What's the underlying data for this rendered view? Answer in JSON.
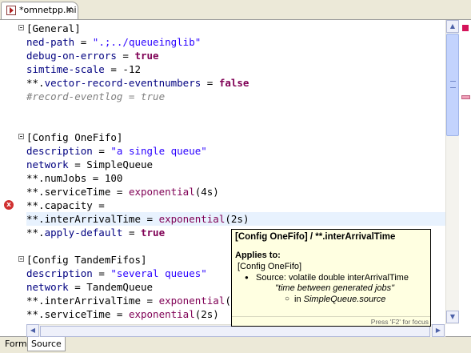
{
  "editor_tab": {
    "title": "*omnetpp.ini",
    "close": "✕"
  },
  "lines": [
    {
      "html": "[General]"
    },
    {
      "html": "<span class='k'>ned-path</span> = <span class='s'>\".;../queueinglib\"</span>"
    },
    {
      "html": "<span class='k'>debug-on-errors</span> = <span class='kw'>true</span>"
    },
    {
      "html": "<span class='k'>simtime-scale</span> = -12"
    },
    {
      "html": "**.<span class='k'>vector-record-eventnumbers</span> = <span class='kw'>false</span>"
    },
    {
      "html": "<span class='cm'>#record-eventlog = true</span>"
    },
    {
      "html": ""
    },
    {
      "html": ""
    },
    {
      "html": "[Config OneFifo]"
    },
    {
      "html": "<span class='k'>description</span> = <span class='s'>\"a single queue\"</span>"
    },
    {
      "html": "<span class='k'>network</span> = SimpleQueue"
    },
    {
      "html": "**.numJobs = 100"
    },
    {
      "html": "**.serviceTime = <span class='fn'>exponential</span>(4s)"
    },
    {
      "html": "**.capacity ="
    },
    {
      "html": "**.interArrivalTime = <span class='fn'>exponential</span>(2s)"
    },
    {
      "html": "**.<span class='k'>apply-default</span> = <span class='kw'>true</span>"
    },
    {
      "html": ""
    },
    {
      "html": "[Config TandemFifos]"
    },
    {
      "html": "<span class='k'>description</span> = <span class='s'>\"several queues\"</span>"
    },
    {
      "html": "<span class='k'>network</span> = TandemQueue"
    },
    {
      "html": "**.interArrivalTime = <span class='fn'>exponential</span>(2s)"
    },
    {
      "html": "**.serviceTime = <span class='fn'>exponential</span>(2s)"
    }
  ],
  "current_line": 14,
  "error_line": 13,
  "error_glyph": "x",
  "fold_lines": [
    0,
    8,
    17
  ],
  "scroll": {
    "up": "▲",
    "down": "▼",
    "left": "◀",
    "right": "▶"
  },
  "popup": {
    "title": "[Config OneFifo] / **.interArrivalTime",
    "applies_label": "Applies to:",
    "config": "[Config OneFifo]",
    "source_prefix": "Source: volatile double interArrivalTime",
    "description": "\"time between generated jobs\"",
    "in_prefix": "in ",
    "in_module": "SimpleQueue.source",
    "footer": "Press 'F2' for focus"
  },
  "bottom_tabs": [
    {
      "label": "Form",
      "active": false
    },
    {
      "label": "Source",
      "active": true
    }
  ],
  "colors": {
    "keyword": "#7f0055",
    "string": "#2a00ff",
    "key": "#000080",
    "comment": "#808080",
    "current_line": "#e8f2fe",
    "error": "#d03030"
  }
}
